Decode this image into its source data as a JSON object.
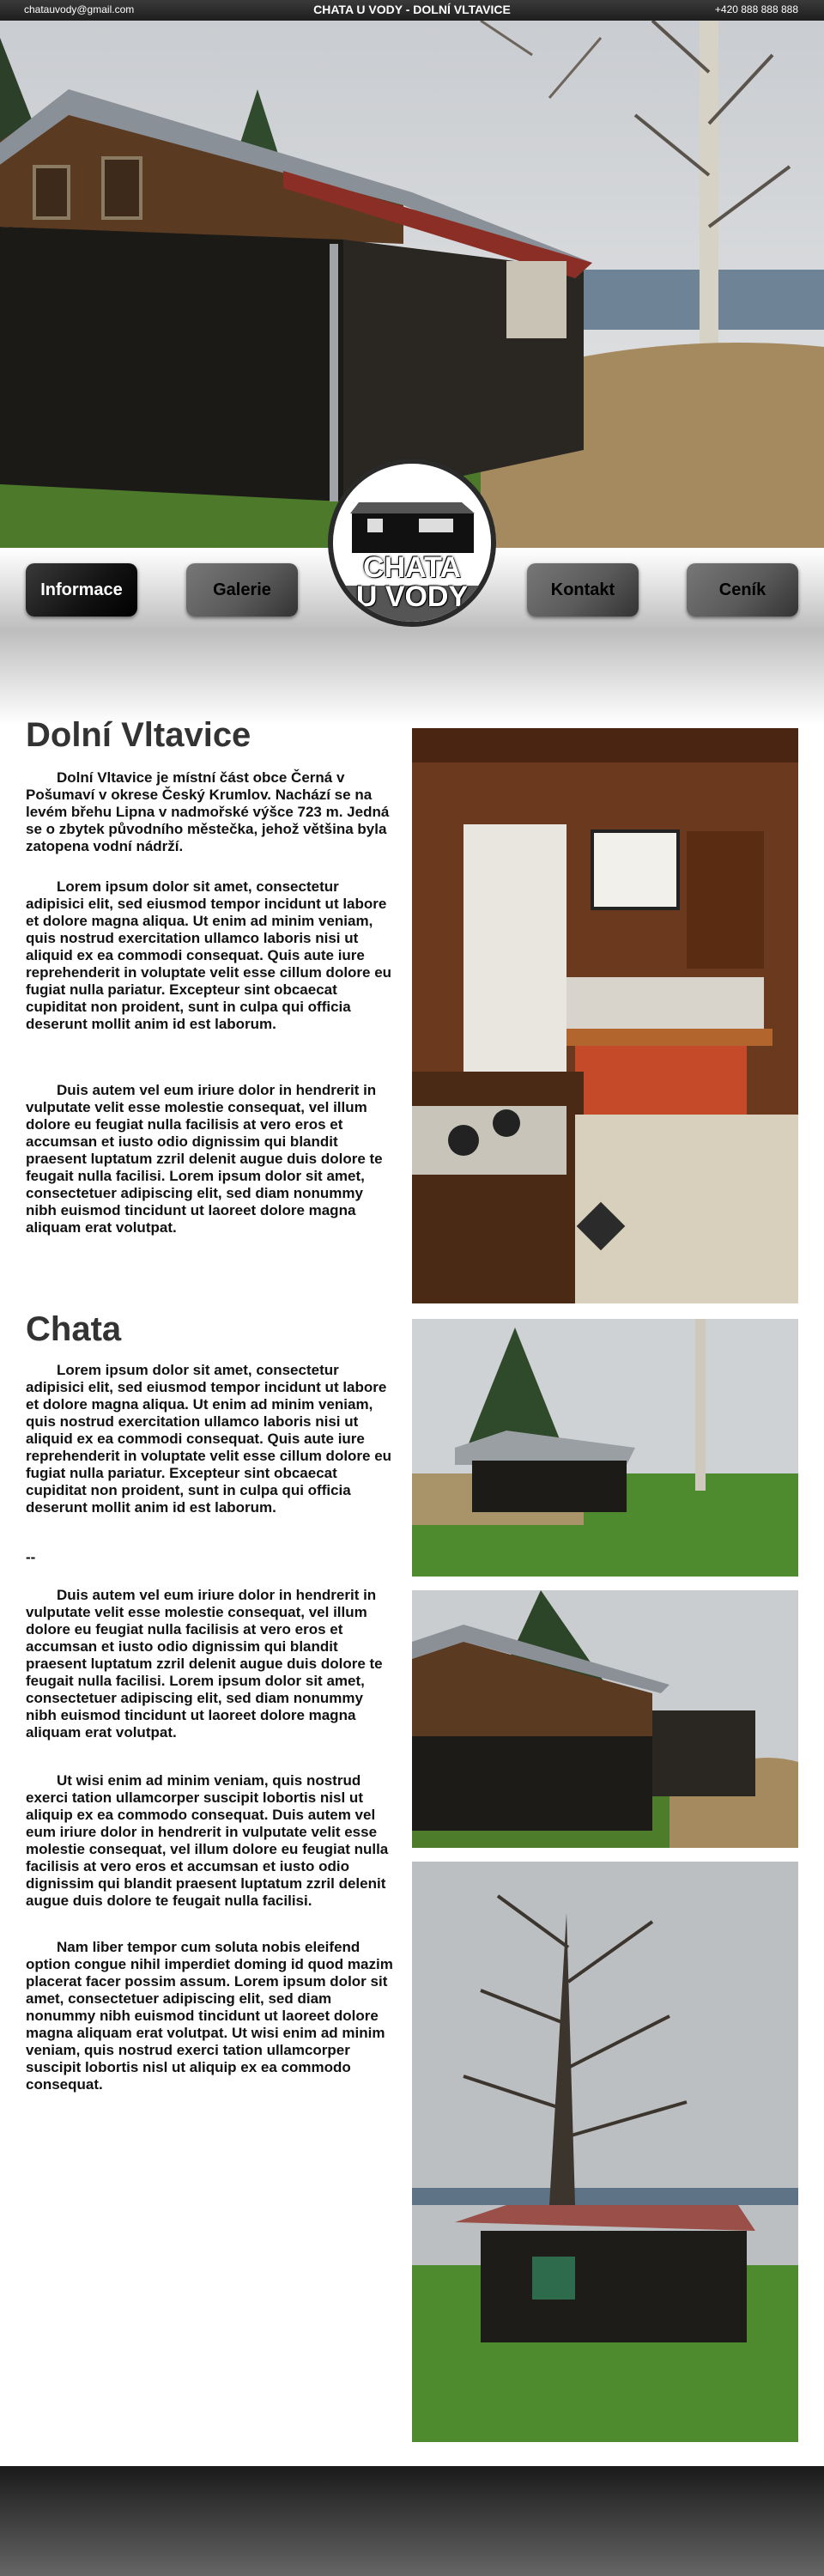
{
  "topbar": {
    "email": "chatauvody@gmail.com",
    "site_title": "CHATA U VODY - DOLNÍ VLTAVICE",
    "phone": "+420 888 888 888"
  },
  "nav": {
    "items": [
      "Informace",
      "Galerie",
      "Kontakt",
      "Ceník"
    ],
    "active": "Informace"
  },
  "logo": {
    "text_line1": "CHATA",
    "text_line2": "U VODY"
  },
  "sections": [
    {
      "heading": "Dolní Vltavice",
      "paragraphs": [
        "Dolní Vltavice je místní část obce Černá v Pošumaví v okrese Český Krumlov. Nachází se na levém břehu Lipna v nadmořské výšce 723 m. Jedná se o zbytek původního městečka, jehož většina byla zatopena vodní nádrží.",
        "Lorem ipsum dolor sit amet, consectetur adipisici elit, sed eiusmod tempor incidunt ut labore et dolore magna aliqua. Ut enim ad minim veniam, quis nostrud exercitation ullamco laboris nisi ut aliquid ex ea commodi consequat. Quis aute iure reprehenderit in voluptate velit esse cillum dolore eu fugiat nulla pariatur. Excepteur sint obcaecat cupiditat non proident, sunt in culpa qui officia deserunt mollit anim id est laborum.",
        "Duis autem vel eum iriure dolor in hendrerit in vulputate velit esse molestie consequat, vel illum dolore eu feugiat nulla facilisis at vero eros et accumsan et iusto odio dignissim qui blandit praesent luptatum zzril delenit augue duis dolore te feugait nulla facilisi. Lorem ipsum dolor sit amet, consectetuer adipiscing elit, sed diam nonummy nibh euismod tincidunt ut laoreet dolore magna aliquam erat volutpat."
      ]
    },
    {
      "heading": "Chata",
      "paragraphs": [
        "Lorem ipsum dolor sit amet, consectetur adipisici elit, sed eiusmod tempor incidunt ut labore et dolore magna aliqua. Ut enim ad minim veniam, quis nostrud exercitation ullamco laboris nisi ut aliquid ex ea commodi consequat. Quis aute iure reprehenderit in voluptate velit esse cillum dolore eu fugiat nulla pariatur. Excepteur sint obcaecat cupiditat non proident, sunt in culpa qui officia deserunt mollit anim id est laborum.",
        "--",
        "Duis autem vel eum iriure dolor in hendrerit in vulputate velit esse molestie consequat, vel illum dolore eu feugiat nulla facilisis at vero eros et accumsan et iusto odio dignissim qui blandit praesent luptatum zzril delenit augue duis dolore te feugait nulla facilisi. Lorem ipsum dolor sit amet, consectetuer adipiscing elit, sed diam nonummy nibh euismod tincidunt ut laoreet dolore magna aliquam erat volutpat.",
        "Ut wisi enim ad minim veniam, quis nostrud exerci tation ullamcorper suscipit lobortis nisl ut aliquip ex ea commodo consequat. Duis autem vel eum iriure dolor in hendrerit in vulputate velit esse molestie consequat, vel illum dolore eu feugiat nulla facilisis at vero eros et accumsan et iusto odio dignissim qui blandit praesent luptatum zzril delenit augue duis dolore te feugait nulla facilisi.",
        "Nam liber tempor cum soluta nobis eleifend option congue nihil imperdiet doming id quod mazim placerat facer possim assum. Lorem ipsum dolor sit amet, consectetuer adipiscing elit, sed diam nonummy nibh euismod tincidunt ut laoreet dolore magna aliquam erat volutpat. Ut wisi enim ad minim veniam, quis nostrud exerci tation ullamcorper suscipit lobortis nisl ut aliquip ex ea commodo consequat."
      ]
    }
  ],
  "colors": {
    "topbar": "#262626",
    "heading": "#333333",
    "button": "#5a5a5a",
    "button_active": "#111111"
  }
}
